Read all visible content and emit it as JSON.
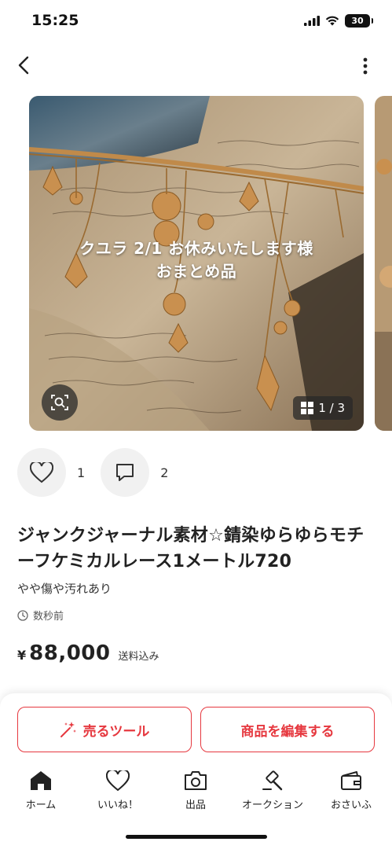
{
  "status_bar": {
    "time": "15:25",
    "battery": "30",
    "icons": [
      "signal-icon",
      "wifi-icon",
      "battery-icon"
    ]
  },
  "nav": {
    "back_icon": "chevron-left-icon",
    "more_icon": "more-vertical-icon"
  },
  "gallery": {
    "overlay_line1": "クユラ 2/1 お休みいたします様",
    "overlay_line2": "おまとめ品",
    "counter": "1 / 3",
    "lens_icon": "image-search-icon"
  },
  "engagement": {
    "likes_count": "1",
    "comments_count": "2"
  },
  "item": {
    "title": "ジャンクジャーナル素材☆錆染ゆらゆらモチーフケミカルレース1メートル720",
    "condition": "やや傷や汚れあり",
    "posted": "数秒前",
    "currency": "¥",
    "price": "88,000",
    "shipping_note": "送料込み"
  },
  "actions": {
    "sell_tool_label": "売るツール",
    "edit_label": "商品を編集する"
  },
  "tabs": [
    {
      "label": "ホーム",
      "icon": "home-icon"
    },
    {
      "label": "いいね！",
      "icon": "heart-icon"
    },
    {
      "label": "出品",
      "icon": "camera-icon"
    },
    {
      "label": "オークション",
      "icon": "gavel-icon"
    },
    {
      "label": "おさいふ",
      "icon": "wallet-icon"
    }
  ],
  "colors": {
    "accent": "#e6383f",
    "text": "#222222"
  }
}
